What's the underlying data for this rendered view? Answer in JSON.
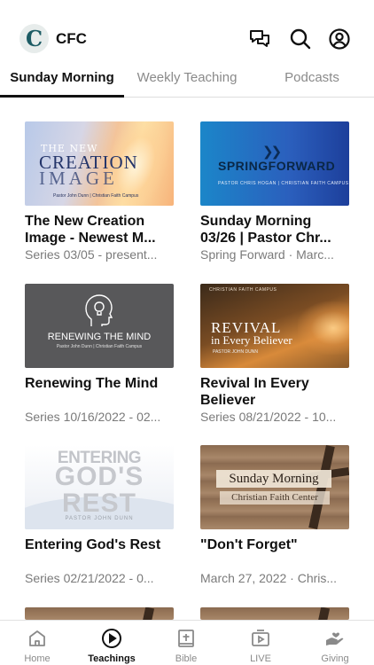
{
  "status_bar": {
    "text": ""
  },
  "header": {
    "logo_letter": "C",
    "org_name": "CFC",
    "icons": [
      "chat-icon",
      "search-icon",
      "account-icon"
    ]
  },
  "tabs": [
    {
      "label": "Sunday Morning",
      "active": true
    },
    {
      "label": "Weekly Teaching",
      "active": false
    },
    {
      "label": "Podcasts",
      "active": false
    }
  ],
  "cards": [
    {
      "title": "The New Creation Image - Newest M...",
      "meta": "Series 03/05 - present...",
      "thumb": {
        "line1": "THE NEW",
        "line2": "CREATION",
        "line3": "IMAGE",
        "line4": "Pastor John Dunn | Christian Faith Campus"
      }
    },
    {
      "title": "Sunday Morning 03/26 | Pastor Chr...",
      "meta": "Spring Forward · Marc...",
      "thumb": {
        "line1": "SPRINGFORWARD",
        "line2": "PASTOR CHRIS HOGAN | CHRISTIAN FAITH CAMPUS"
      }
    },
    {
      "title": "Renewing The Mind",
      "meta": "Series 10/16/2022 - 02...",
      "thumb": {
        "line1": "RENEWING THE MIND",
        "line2": "Pastor John Dunn | Christian Faith Campus"
      }
    },
    {
      "title": "Revival In Every Believer",
      "meta": "Series 08/21/2022 - 10...",
      "thumb": {
        "line0": "CHRISTIAN FAITH CAMPUS",
        "line1": "REVIVAL",
        "line2": "in Every Believer",
        "line3": "PASTOR JOHN DUNN"
      }
    },
    {
      "title": "Entering God's Rest",
      "meta": "Series 02/21/2022 - 0...",
      "thumb": {
        "line1": "ENTERING",
        "line2": "GOD'S REST",
        "line3": "PASTOR JOHN DUNN"
      }
    },
    {
      "title": "\"Don't Forget\"",
      "meta": "March 27, 2022 · Chris...",
      "thumb": {
        "line1": "Sunday Morning",
        "line2": "Christian Faith Center"
      }
    }
  ],
  "tabbar": [
    {
      "label": "Home",
      "icon": "home-icon",
      "active": false
    },
    {
      "label": "Teachings",
      "icon": "play-circle-icon",
      "active": true
    },
    {
      "label": "Bible",
      "icon": "bible-icon",
      "active": false
    },
    {
      "label": "LIVE",
      "icon": "live-tv-icon",
      "active": false
    },
    {
      "label": "Giving",
      "icon": "giving-hand-icon",
      "active": false
    }
  ]
}
